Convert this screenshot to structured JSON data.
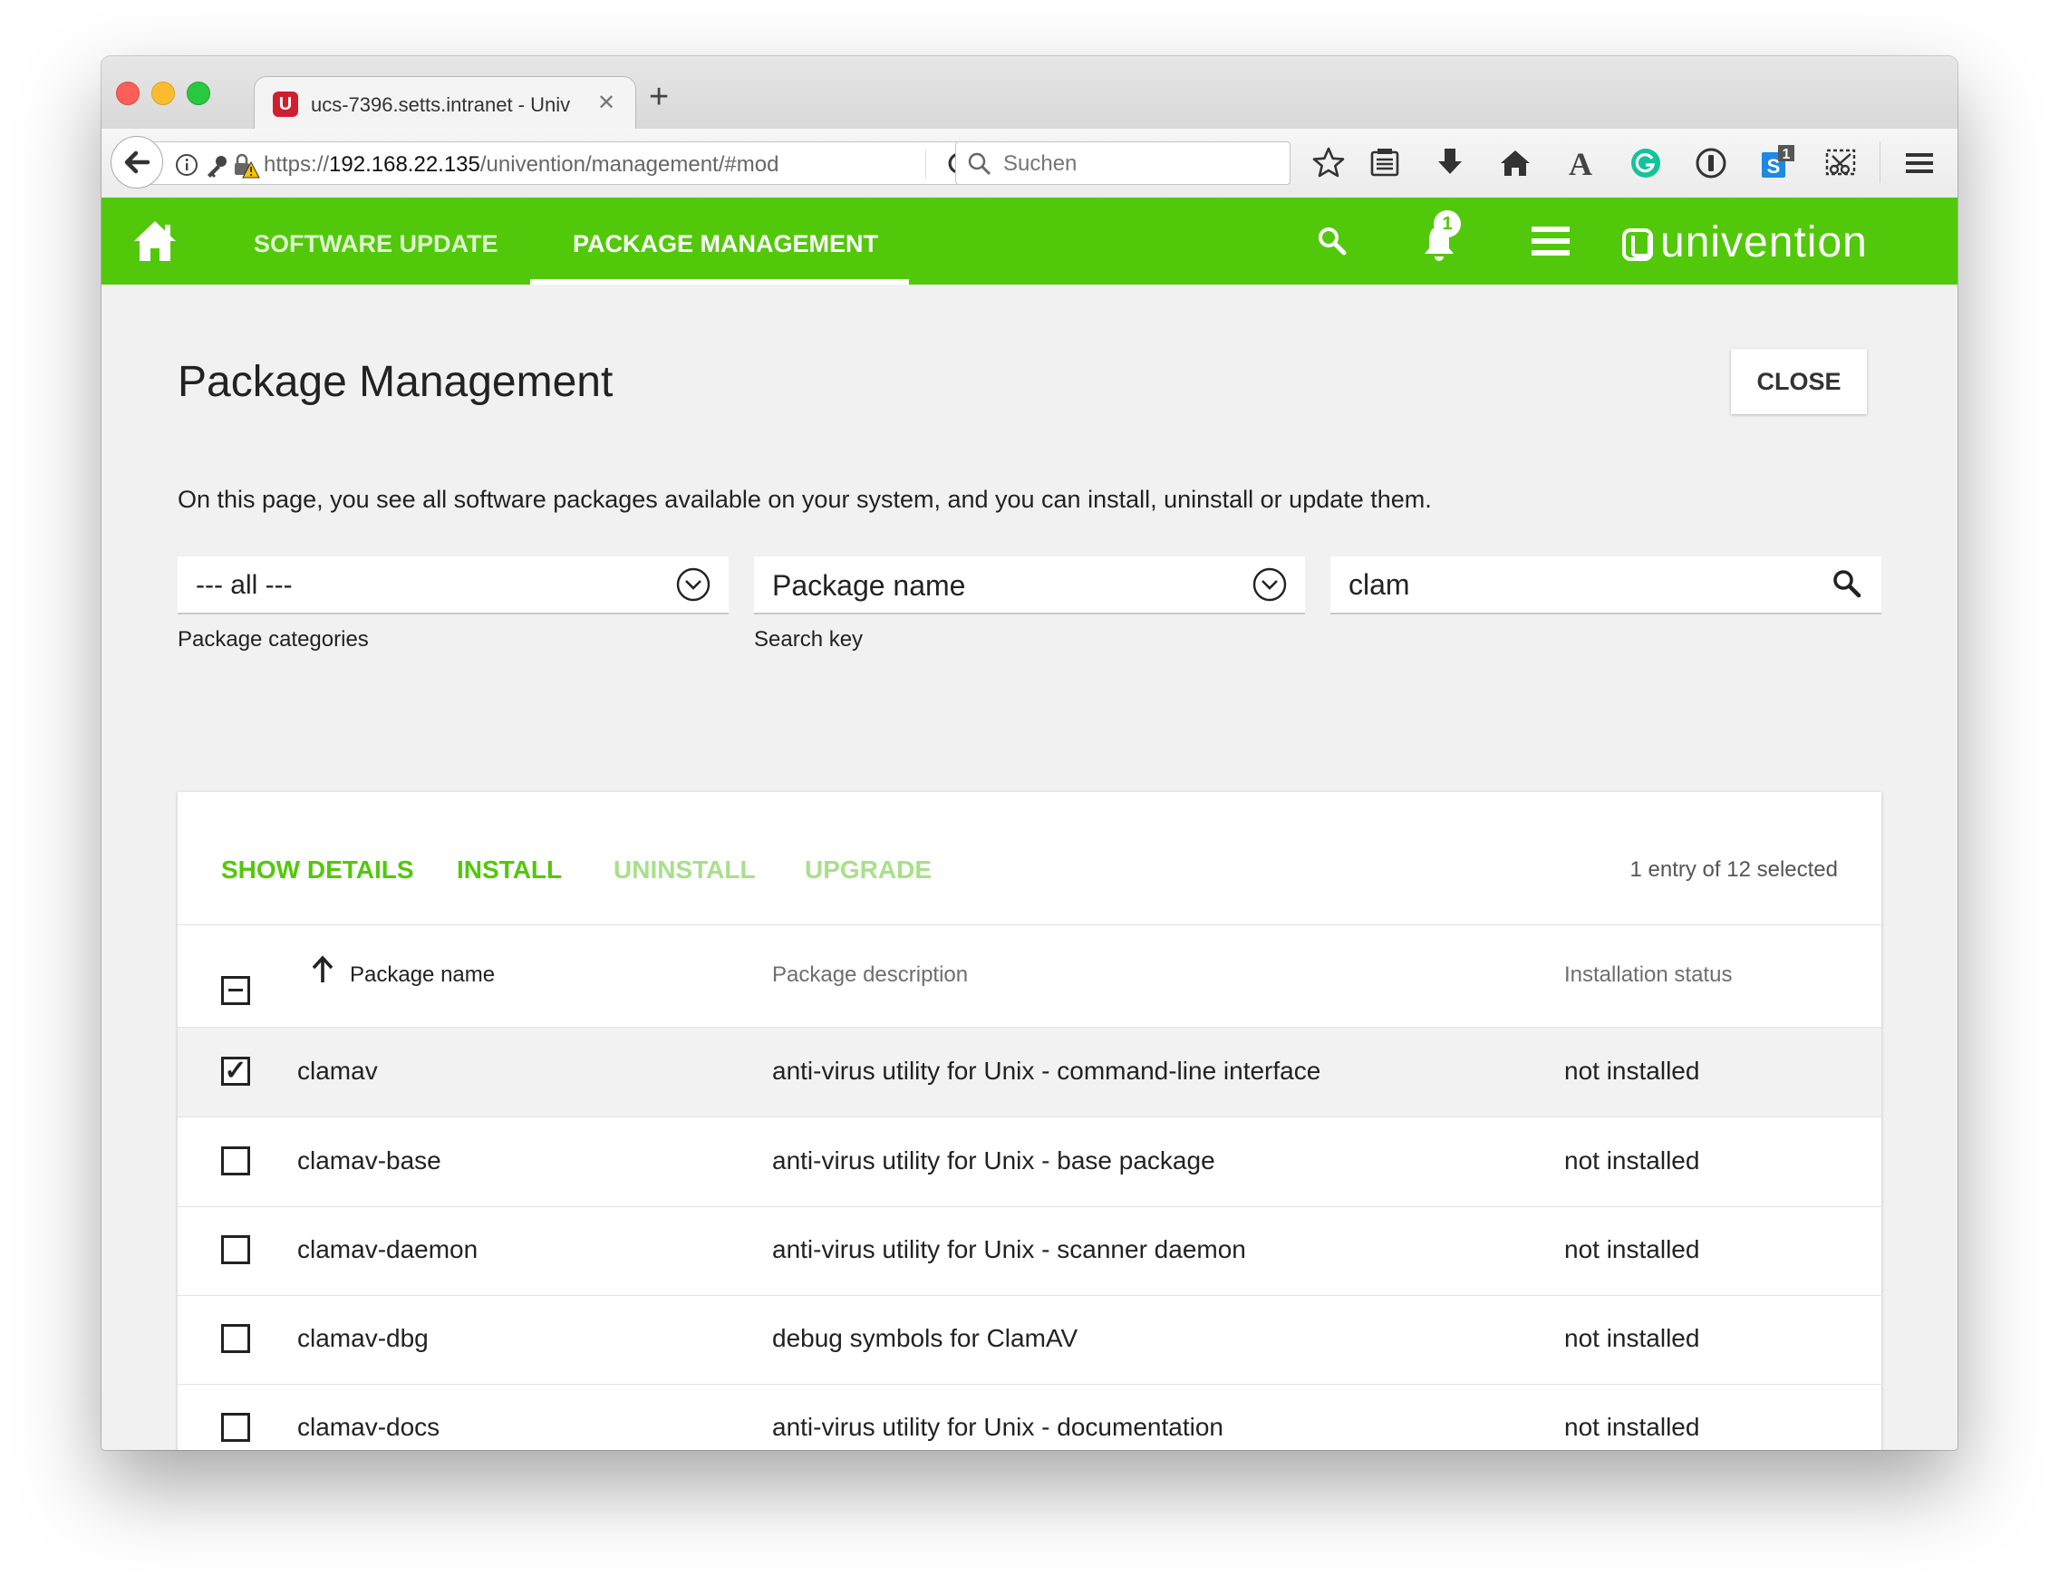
{
  "browser": {
    "tab_title": "ucs-7396.setts.intranet - Univ",
    "url_scheme": "https://",
    "url_host": "192.168.22.135",
    "url_path": "/univention/management/#mod",
    "search_placeholder": "Suchen",
    "extension_badge": "1"
  },
  "header": {
    "nav": [
      {
        "label": "SOFTWARE UPDATE",
        "active": false
      },
      {
        "label": "PACKAGE MANAGEMENT",
        "active": true
      }
    ],
    "notification_count": "1",
    "logo_text": "univention",
    "brand_color": "#52c80a"
  },
  "page": {
    "title": "Package Management",
    "close_label": "CLOSE",
    "description": "On this page, you see all software packages available on your system, and you can install, uninstall or update them."
  },
  "filters": {
    "category": {
      "value": "--- all ---",
      "label": "Package categories"
    },
    "search_key": {
      "value": "Package name",
      "label": "Search key"
    },
    "search": {
      "value": "clam"
    }
  },
  "grid": {
    "actions": [
      {
        "label": "SHOW DETAILS",
        "enabled": true
      },
      {
        "label": "INSTALL",
        "enabled": true
      },
      {
        "label": "UNINSTALL",
        "enabled": false
      },
      {
        "label": "UPGRADE",
        "enabled": false
      }
    ],
    "selection_status": "1 entry of 12 selected",
    "columns": [
      "Package name",
      "Package description",
      "Installation status"
    ],
    "rows": [
      {
        "name": "clamav",
        "description": "anti-virus utility for Unix - command-line interface",
        "status": "not installed",
        "selected": true
      },
      {
        "name": "clamav-base",
        "description": "anti-virus utility for Unix - base package",
        "status": "not installed",
        "selected": false
      },
      {
        "name": "clamav-daemon",
        "description": "anti-virus utility for Unix - scanner daemon",
        "status": "not installed",
        "selected": false
      },
      {
        "name": "clamav-dbg",
        "description": "debug symbols for ClamAV",
        "status": "not installed",
        "selected": false
      },
      {
        "name": "clamav-docs",
        "description": "anti-virus utility for Unix - documentation",
        "status": "not installed",
        "selected": false
      }
    ]
  }
}
